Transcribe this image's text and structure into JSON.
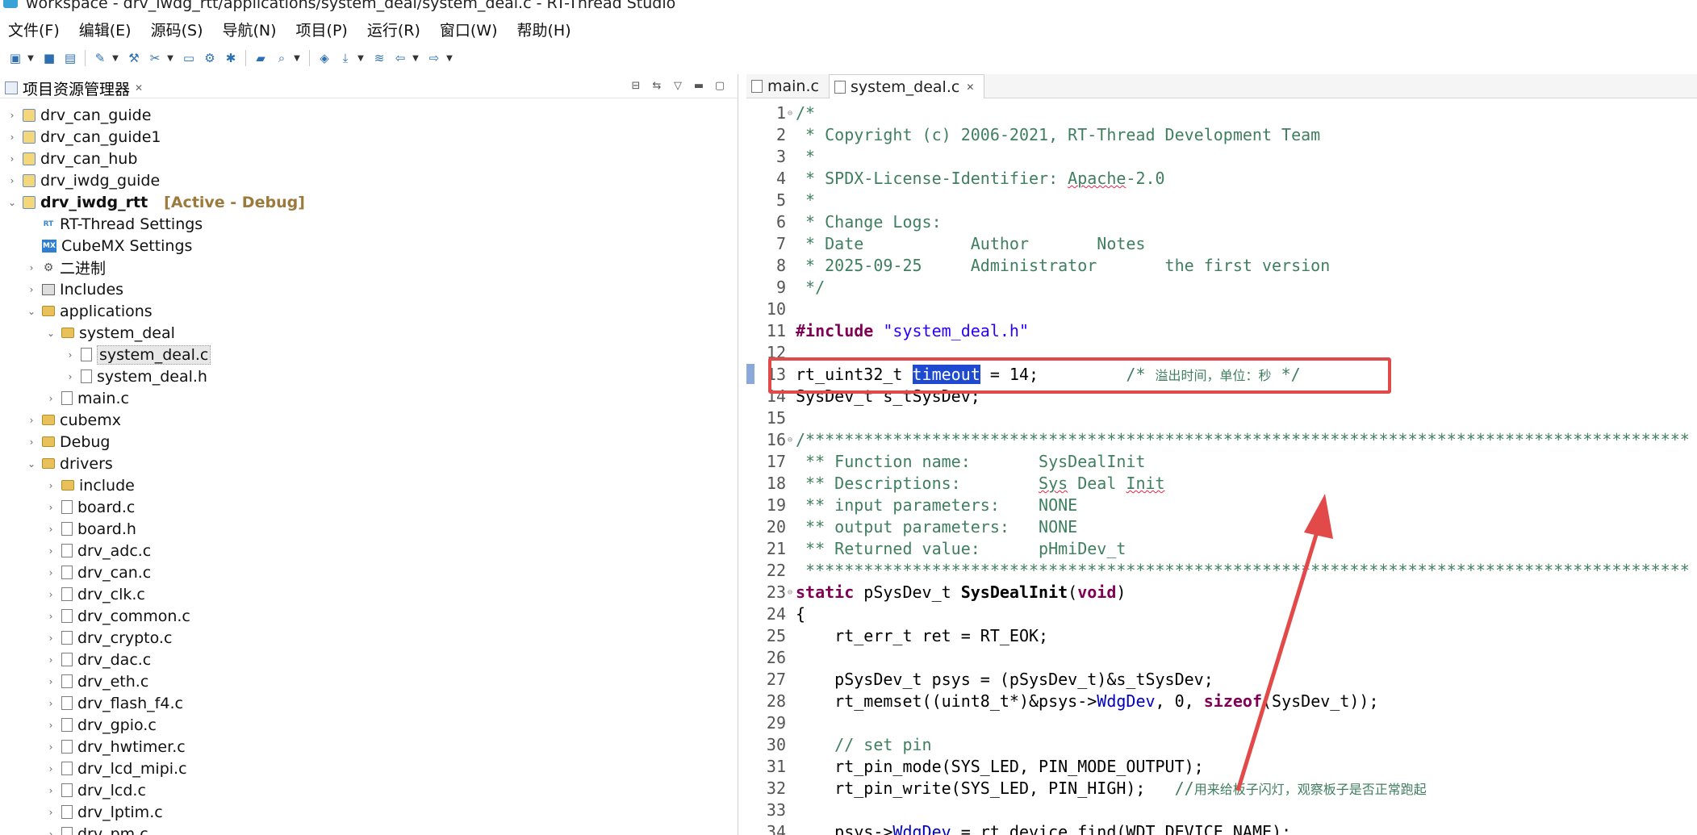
{
  "window": {
    "title": "workspace - drv_iwdg_rtt/applications/system_deal/system_deal.c - RT-Thread Studio"
  },
  "menu": [
    "文件(F)",
    "编辑(E)",
    "源码(S)",
    "导航(N)",
    "项目(P)",
    "运行(R)",
    "窗口(W)",
    "帮助(H)"
  ],
  "explorer": {
    "title": "项目资源管理器",
    "tree": [
      {
        "label": "drv_can_guide",
        "depth": 0,
        "icon": "proj",
        "chev": "›"
      },
      {
        "label": "drv_can_guide1",
        "depth": 0,
        "icon": "proj",
        "chev": "›"
      },
      {
        "label": "drv_can_hub",
        "depth": 0,
        "icon": "proj",
        "chev": "›"
      },
      {
        "label": "drv_iwdg_guide",
        "depth": 0,
        "icon": "proj",
        "chev": "›"
      },
      {
        "label": "drv_iwdg_rtt",
        "depth": 0,
        "icon": "proj",
        "chev": "⌄",
        "bold": true,
        "status": "[Active - Debug]"
      },
      {
        "label": "RT-Thread Settings",
        "depth": 1,
        "icon": "rt",
        "chev": "",
        "glyph": "RT"
      },
      {
        "label": "CubeMX Settings",
        "depth": 1,
        "icon": "mx",
        "chev": "",
        "glyph": "MX"
      },
      {
        "label": "二进制",
        "depth": 1,
        "icon": "bin",
        "chev": "›",
        "glyph": "⚙"
      },
      {
        "label": "Includes",
        "depth": 1,
        "icon": "inc",
        "chev": "›"
      },
      {
        "label": "applications",
        "depth": 1,
        "icon": "folder",
        "chev": "⌄"
      },
      {
        "label": "system_deal",
        "depth": 2,
        "icon": "folder",
        "chev": "⌄"
      },
      {
        "label": "system_deal.c",
        "depth": 3,
        "icon": "file",
        "chev": "›",
        "selected": true
      },
      {
        "label": "system_deal.h",
        "depth": 3,
        "icon": "file",
        "chev": "›"
      },
      {
        "label": "main.c",
        "depth": 2,
        "icon": "file",
        "chev": "›"
      },
      {
        "label": "cubemx",
        "depth": 1,
        "icon": "folder",
        "chev": "›"
      },
      {
        "label": "Debug",
        "depth": 1,
        "icon": "folder",
        "chev": "›"
      },
      {
        "label": "drivers",
        "depth": 1,
        "icon": "folder",
        "chev": "⌄"
      },
      {
        "label": "include",
        "depth": 2,
        "icon": "folder",
        "chev": "›"
      },
      {
        "label": "board.c",
        "depth": 2,
        "icon": "file",
        "chev": "›"
      },
      {
        "label": "board.h",
        "depth": 2,
        "icon": "file",
        "chev": "›"
      },
      {
        "label": "drv_adc.c",
        "depth": 2,
        "icon": "file",
        "chev": "›"
      },
      {
        "label": "drv_can.c",
        "depth": 2,
        "icon": "file",
        "chev": "›"
      },
      {
        "label": "drv_clk.c",
        "depth": 2,
        "icon": "file",
        "chev": "›"
      },
      {
        "label": "drv_common.c",
        "depth": 2,
        "icon": "file",
        "chev": "›"
      },
      {
        "label": "drv_crypto.c",
        "depth": 2,
        "icon": "file",
        "chev": "›"
      },
      {
        "label": "drv_dac.c",
        "depth": 2,
        "icon": "file",
        "chev": "›"
      },
      {
        "label": "drv_eth.c",
        "depth": 2,
        "icon": "file",
        "chev": "›"
      },
      {
        "label": "drv_flash_f4.c",
        "depth": 2,
        "icon": "file",
        "chev": "›"
      },
      {
        "label": "drv_gpio.c",
        "depth": 2,
        "icon": "file",
        "chev": "›"
      },
      {
        "label": "drv_hwtimer.c",
        "depth": 2,
        "icon": "file",
        "chev": "›"
      },
      {
        "label": "drv_lcd_mipi.c",
        "depth": 2,
        "icon": "file",
        "chev": "›"
      },
      {
        "label": "drv_lcd.c",
        "depth": 2,
        "icon": "file",
        "chev": "›"
      },
      {
        "label": "drv_lptim.c",
        "depth": 2,
        "icon": "file",
        "chev": "›"
      },
      {
        "label": "drv_pm.c",
        "depth": 2,
        "icon": "file",
        "chev": "›"
      }
    ]
  },
  "editor": {
    "tabs": [
      {
        "label": "main.c",
        "active": false
      },
      {
        "label": "system_deal.c",
        "active": true
      }
    ],
    "lines": [
      {
        "n": "1",
        "fold": true,
        "segs": [
          [
            "cm",
            "/*"
          ]
        ]
      },
      {
        "n": "2",
        "segs": [
          [
            "cm",
            " * Copyright (c) 2006-2021, RT-Thread Development Team"
          ]
        ]
      },
      {
        "n": "3",
        "segs": [
          [
            "cm",
            " *"
          ]
        ]
      },
      {
        "n": "4",
        "segs": [
          [
            "cm",
            " * SPDX-License-Identifier: "
          ],
          [
            "cm sq",
            "Apache"
          ],
          [
            "cm",
            "-2.0"
          ]
        ]
      },
      {
        "n": "5",
        "segs": [
          [
            "cm",
            " *"
          ]
        ]
      },
      {
        "n": "6",
        "segs": [
          [
            "cm",
            " * Change Logs:"
          ]
        ]
      },
      {
        "n": "7",
        "segs": [
          [
            "cm",
            " * Date           Author       Notes"
          ]
        ]
      },
      {
        "n": "8",
        "segs": [
          [
            "cm",
            " * 2025-09-25     Administrator       the first version"
          ]
        ]
      },
      {
        "n": "9",
        "segs": [
          [
            "cm",
            " */"
          ]
        ]
      },
      {
        "n": "10",
        "segs": []
      },
      {
        "n": "11",
        "segs": [
          [
            "kw",
            "#include"
          ],
          [
            "ct",
            " "
          ],
          [
            "str",
            "\"system_deal.h\""
          ]
        ]
      },
      {
        "n": "12",
        "segs": []
      },
      {
        "n": "13",
        "segs": [
          [
            "ct",
            "rt_uint32_t "
          ],
          [
            "hl",
            "timeout"
          ],
          [
            "ct",
            " = 14;         "
          ],
          [
            "cm",
            "/* "
          ],
          [
            "cm zh",
            "溢出时间，单位：秒"
          ],
          [
            "cm",
            " */"
          ]
        ]
      },
      {
        "n": "14",
        "segs": [
          [
            "ct",
            "SysDev_t s_tSysDev;"
          ]
        ]
      },
      {
        "n": "15",
        "segs": []
      },
      {
        "n": "16",
        "fold": true,
        "segs": [
          [
            "cm",
            "/*******************************************************************************************"
          ]
        ]
      },
      {
        "n": "17",
        "segs": [
          [
            "cm",
            " ** Function name:       SysDealInit"
          ]
        ]
      },
      {
        "n": "18",
        "segs": [
          [
            "cm",
            " ** Descriptions:        "
          ],
          [
            "cm sq",
            "Sys"
          ],
          [
            "cm",
            " Deal "
          ],
          [
            "cm sq",
            "Init"
          ]
        ]
      },
      {
        "n": "19",
        "segs": [
          [
            "cm",
            " ** input parameters:    NONE"
          ]
        ]
      },
      {
        "n": "20",
        "segs": [
          [
            "cm",
            " ** output parameters:   NONE"
          ]
        ]
      },
      {
        "n": "21",
        "segs": [
          [
            "cm",
            " ** Returned value:      pHmiDev_t"
          ]
        ]
      },
      {
        "n": "22",
        "segs": [
          [
            "cm",
            " *******************************************************************************************"
          ]
        ]
      },
      {
        "n": "23",
        "fold": true,
        "segs": [
          [
            "kw",
            "static"
          ],
          [
            "ct",
            " pSysDev_t "
          ],
          [
            "ct b",
            "SysDealInit"
          ],
          [
            "ct",
            "("
          ],
          [
            "kw",
            "void"
          ],
          [
            "ct",
            ")"
          ]
        ]
      },
      {
        "n": "24",
        "segs": [
          [
            "ct",
            "{"
          ]
        ]
      },
      {
        "n": "25",
        "segs": [
          [
            "ct",
            "    rt_err_t ret = RT_EOK;"
          ]
        ]
      },
      {
        "n": "26",
        "segs": []
      },
      {
        "n": "27",
        "segs": [
          [
            "ct",
            "    pSysDev_t psys = (pSysDev_t)&s_tSysDev;"
          ]
        ]
      },
      {
        "n": "28",
        "segs": [
          [
            "ct",
            "    rt_memset((uint8_t*)&psys->"
          ],
          [
            "fld",
            "WdgDev"
          ],
          [
            "ct",
            ", 0, "
          ],
          [
            "kw",
            "sizeof"
          ],
          [
            "ct",
            "(SysDev_t));"
          ]
        ]
      },
      {
        "n": "29",
        "segs": []
      },
      {
        "n": "30",
        "segs": [
          [
            "cm",
            "    // set pin"
          ]
        ]
      },
      {
        "n": "31",
        "segs": [
          [
            "ct",
            "    rt_pin_mode(SYS_LED, PIN_MODE_OUTPUT);"
          ]
        ]
      },
      {
        "n": "32",
        "segs": [
          [
            "ct",
            "    rt_pin_write(SYS_LED, PIN_HIGH);   "
          ],
          [
            "cm",
            "//"
          ],
          [
            "cm zh",
            "用来给板子闪灯，观察板子是否正常跑起"
          ]
        ]
      },
      {
        "n": "33",
        "segs": []
      },
      {
        "n": "34",
        "segs": [
          [
            "ct",
            "    psys->"
          ],
          [
            "fld",
            "WdgDev"
          ],
          [
            "ct",
            " = rt_device_find(WDT_DEVICE_NAME);"
          ]
        ]
      }
    ]
  },
  "annotation": {
    "color": "#e24a4a"
  }
}
